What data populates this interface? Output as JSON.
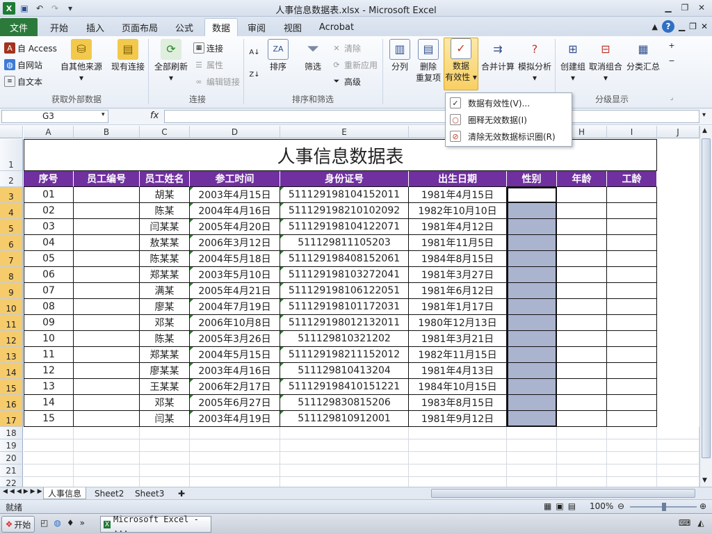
{
  "window": {
    "title": "人事信息数据表.xlsx - Microsoft Excel"
  },
  "tabs": {
    "file": "文件",
    "items": [
      "开始",
      "插入",
      "页面布局",
      "公式",
      "数据",
      "审阅",
      "视图",
      "Acrobat"
    ],
    "active": "数据"
  },
  "ribbon": {
    "external": {
      "access": "自 Access",
      "web": "自网站",
      "text": "自文本",
      "other": "自其他来源",
      "existing": "现有连接",
      "label": "获取外部数据"
    },
    "connections": {
      "refresh_all": "全部刷新",
      "connections": "连接",
      "properties": "属性",
      "edit_links": "编辑链接",
      "label": "连接"
    },
    "sort_filter": {
      "sort": "排序",
      "filter": "筛选",
      "clear": "清除",
      "reapply": "重新应用",
      "advanced": "高级",
      "label": "排序和筛选"
    },
    "data_tools": {
      "split": "分列",
      "remove_dup_1": "删除",
      "remove_dup_2": "重复项",
      "validation_1": "数据",
      "validation_2": "有效性",
      "consolidate": "合并计算",
      "whatif": "模拟分析"
    },
    "outline": {
      "group": "创建组",
      "ungroup": "取消组合",
      "subtotal": "分类汇总",
      "label": "分级显示"
    }
  },
  "validation_menu": {
    "items": [
      "数据有效性(V)...",
      "圈释无效数据(I)",
      "清除无效数据标识圈(R)"
    ]
  },
  "formula_bar": {
    "name_box": "G3",
    "fx": "fx",
    "formula": ""
  },
  "sheet": {
    "columns": [
      "A",
      "B",
      "C",
      "D",
      "E",
      "F",
      "G",
      "H",
      "I",
      "J"
    ],
    "title": "人事信息数据表",
    "headers": [
      "序号",
      "员工编号",
      "员工姓名",
      "参工时间",
      "身份证号",
      "出生日期",
      "性别",
      "年龄",
      "工龄"
    ],
    "rows": [
      [
        "01",
        "",
        "胡某",
        "2003年4月15日",
        "511129198104152011",
        "1981年4月15日"
      ],
      [
        "02",
        "",
        "陈某",
        "2004年4月16日",
        "511129198210102092",
        "1982年10月10日"
      ],
      [
        "03",
        "",
        "闫某某",
        "2005年4月20日",
        "511129198104122071",
        "1981年4月12日"
      ],
      [
        "04",
        "",
        "敖某某",
        "2006年3月12日",
        "511129811105203",
        "1981年11月5日"
      ],
      [
        "05",
        "",
        "陈某某",
        "2004年5月18日",
        "511129198408152061",
        "1984年8月15日"
      ],
      [
        "06",
        "",
        "郑某某",
        "2003年5月10日",
        "511129198103272041",
        "1981年3月27日"
      ],
      [
        "07",
        "",
        "满某",
        "2005年4月21日",
        "511129198106122051",
        "1981年6月12日"
      ],
      [
        "08",
        "",
        "廖某",
        "2004年7月19日",
        "511129198101172031",
        "1981年1月17日"
      ],
      [
        "09",
        "",
        "邓某",
        "2006年10月8日",
        "511129198012132011",
        "1980年12月13日"
      ],
      [
        "10",
        "",
        "陈某",
        "2005年3月26日",
        "511129810321202",
        "1981年3月21日"
      ],
      [
        "11",
        "",
        "郑某某",
        "2004年5月15日",
        "511129198211152012",
        "1982年11月15日"
      ],
      [
        "12",
        "",
        "廖某某",
        "2003年4月16日",
        "511129810413204",
        "1981年4月13日"
      ],
      [
        "13",
        "",
        "王某某",
        "2006年2月17日",
        "511129198410151221",
        "1984年10月15日"
      ],
      [
        "14",
        "",
        "邓某",
        "2005年6月27日",
        "511129830815206",
        "1983年8月15日"
      ],
      [
        "15",
        "",
        "闫某",
        "2003年4月19日",
        "511129810912001",
        "1981年9月12日"
      ]
    ],
    "empty_rows": [
      "18",
      "19",
      "20",
      "21",
      "22"
    ]
  },
  "sheet_tabs": [
    "人事信息",
    "Sheet2",
    "Sheet3"
  ],
  "status": {
    "ready": "就绪",
    "zoom": "100%"
  },
  "taskbar": {
    "start": "开始",
    "task": "Microsoft Excel - ..."
  },
  "colors": {
    "header_bg": "#7030a0",
    "selection": "#aab4cf",
    "file_tab": "#2b7a3b"
  }
}
